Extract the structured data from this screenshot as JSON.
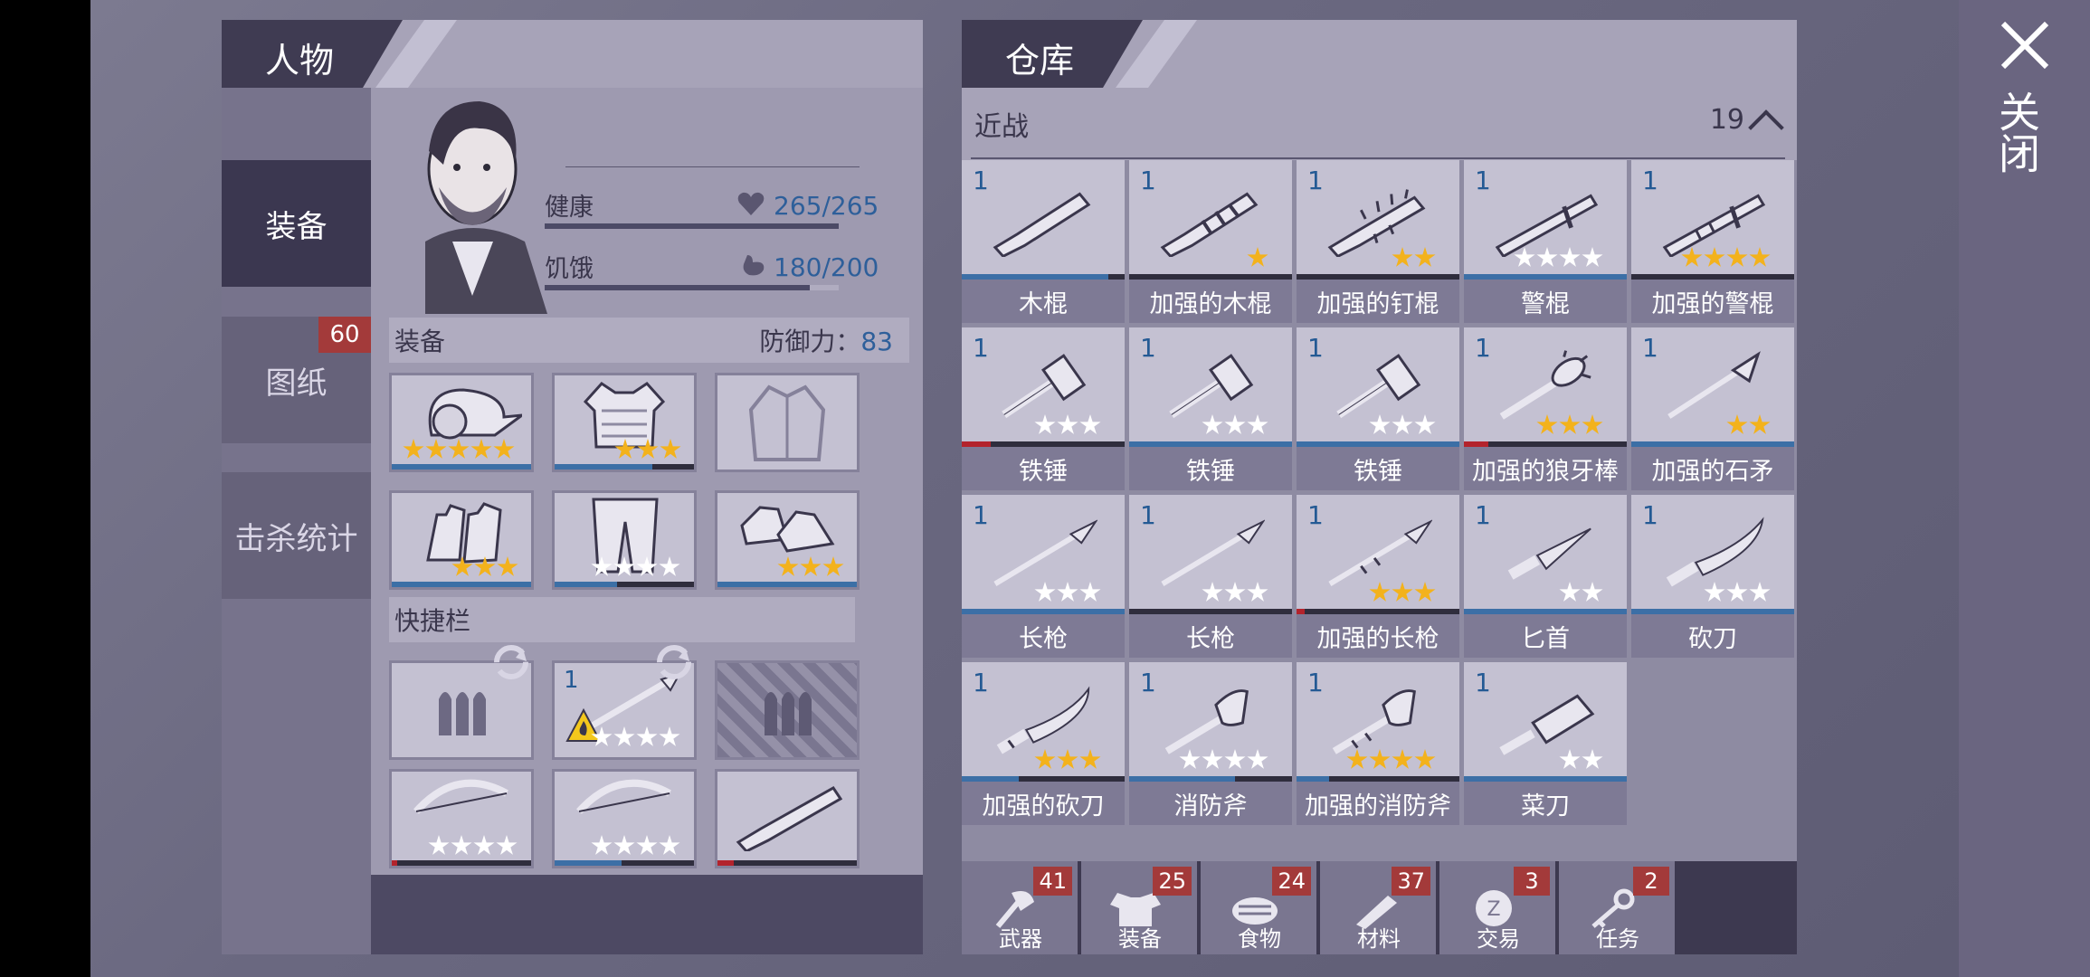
{
  "close": {
    "label": "关闭"
  },
  "character": {
    "title": "人物",
    "nav": [
      {
        "label": "装备",
        "badge": ""
      },
      {
        "label": "图纸",
        "badge": "60"
      },
      {
        "label": "击杀统计",
        "badge": ""
      }
    ],
    "health": {
      "label": "健康",
      "value": "265/265",
      "fill": 1.0
    },
    "hunger": {
      "label": "饥饿",
      "value": "180/200",
      "fill": 0.9
    },
    "equip_section": {
      "label": "装备",
      "defense_label": "防御力：",
      "defense_value": "83"
    },
    "quickbar_section": {
      "label": "快捷栏"
    },
    "quickbar_qty": "1"
  },
  "warehouse": {
    "title": "仓库",
    "category": {
      "label": "近战",
      "count": "19"
    },
    "items": [
      {
        "name": "木棍",
        "qty": "1",
        "stars": 0,
        "gold": 0,
        "dur": 0.9,
        "red": false,
        "icon": "club-icon"
      },
      {
        "name": "加强的木棍",
        "qty": "1",
        "stars": 1,
        "gold": 1,
        "dur": 0,
        "red": false,
        "icon": "reinforced-club-icon"
      },
      {
        "name": "加强的钉棍",
        "qty": "1",
        "stars": 2,
        "gold": 2,
        "dur": 0,
        "red": false,
        "icon": "spiked-club-icon"
      },
      {
        "name": "警棍",
        "qty": "1",
        "stars": 4,
        "gold": 0,
        "dur": 1.0,
        "red": false,
        "icon": "baton-icon"
      },
      {
        "name": "加强的警棍",
        "qty": "1",
        "stars": 4,
        "gold": 4,
        "dur": 0,
        "red": false,
        "icon": "reinforced-baton-icon"
      },
      {
        "name": "铁锤",
        "qty": "1",
        "stars": 3,
        "gold": 0,
        "dur": 0.18,
        "red": true,
        "icon": "hammer-icon"
      },
      {
        "name": "铁锤",
        "qty": "1",
        "stars": 3,
        "gold": 0,
        "dur": 1.0,
        "red": false,
        "icon": "hammer-icon"
      },
      {
        "name": "铁锤",
        "qty": "1",
        "stars": 3,
        "gold": 0,
        "dur": 1.0,
        "red": false,
        "icon": "hammer-icon"
      },
      {
        "name": "加强的狼牙棒",
        "qty": "1",
        "stars": 3,
        "gold": 3,
        "dur": 0.15,
        "red": true,
        "icon": "mace-icon"
      },
      {
        "name": "加强的石矛",
        "qty": "1",
        "stars": 2,
        "gold": 2,
        "dur": 1.0,
        "red": false,
        "icon": "stone-spear-icon"
      },
      {
        "name": "长枪",
        "qty": "1",
        "stars": 3,
        "gold": 0,
        "dur": 1.0,
        "red": false,
        "icon": "spear-icon"
      },
      {
        "name": "长枪",
        "qty": "1",
        "stars": 3,
        "gold": 0,
        "dur": 0.0,
        "red": false,
        "icon": "spear-icon"
      },
      {
        "name": "加强的长枪",
        "qty": "1",
        "stars": 3,
        "gold": 3,
        "dur": 0.05,
        "red": true,
        "icon": "reinforced-spear-icon"
      },
      {
        "name": "匕首",
        "qty": "1",
        "stars": 2,
        "gold": 0,
        "dur": 1.0,
        "red": false,
        "icon": "dagger-icon"
      },
      {
        "name": "砍刀",
        "qty": "1",
        "stars": 3,
        "gold": 0,
        "dur": 1.0,
        "red": false,
        "icon": "machete-icon"
      },
      {
        "name": "加强的砍刀",
        "qty": "1",
        "stars": 3,
        "gold": 3,
        "dur": 0.35,
        "red": false,
        "icon": "reinforced-machete-icon"
      },
      {
        "name": "消防斧",
        "qty": "1",
        "stars": 4,
        "gold": 0,
        "dur": 0.65,
        "red": false,
        "icon": "fire-axe-icon"
      },
      {
        "name": "加强的消防斧",
        "qty": "1",
        "stars": 4,
        "gold": 4,
        "dur": 0.2,
        "red": false,
        "icon": "reinforced-fire-axe-icon"
      },
      {
        "name": "菜刀",
        "qty": "1",
        "stars": 2,
        "gold": 0,
        "dur": 1.0,
        "red": false,
        "icon": "cleaver-icon"
      }
    ],
    "categories": [
      {
        "label": "武器",
        "badge": "41",
        "icon": "axe-icon"
      },
      {
        "label": "装备",
        "badge": "25",
        "icon": "shirt-icon"
      },
      {
        "label": "食物",
        "badge": "24",
        "icon": "food-icon"
      },
      {
        "label": "材料",
        "badge": "37",
        "icon": "material-icon"
      },
      {
        "label": "交易",
        "badge": "3",
        "icon": "coin-icon"
      },
      {
        "label": "任务",
        "badge": "2",
        "icon": "key-icon"
      }
    ]
  },
  "colors": {
    "accent_blue": "#3c6fa6",
    "badge_red": "#a33a3a",
    "star_gold": "#f3b21c"
  }
}
